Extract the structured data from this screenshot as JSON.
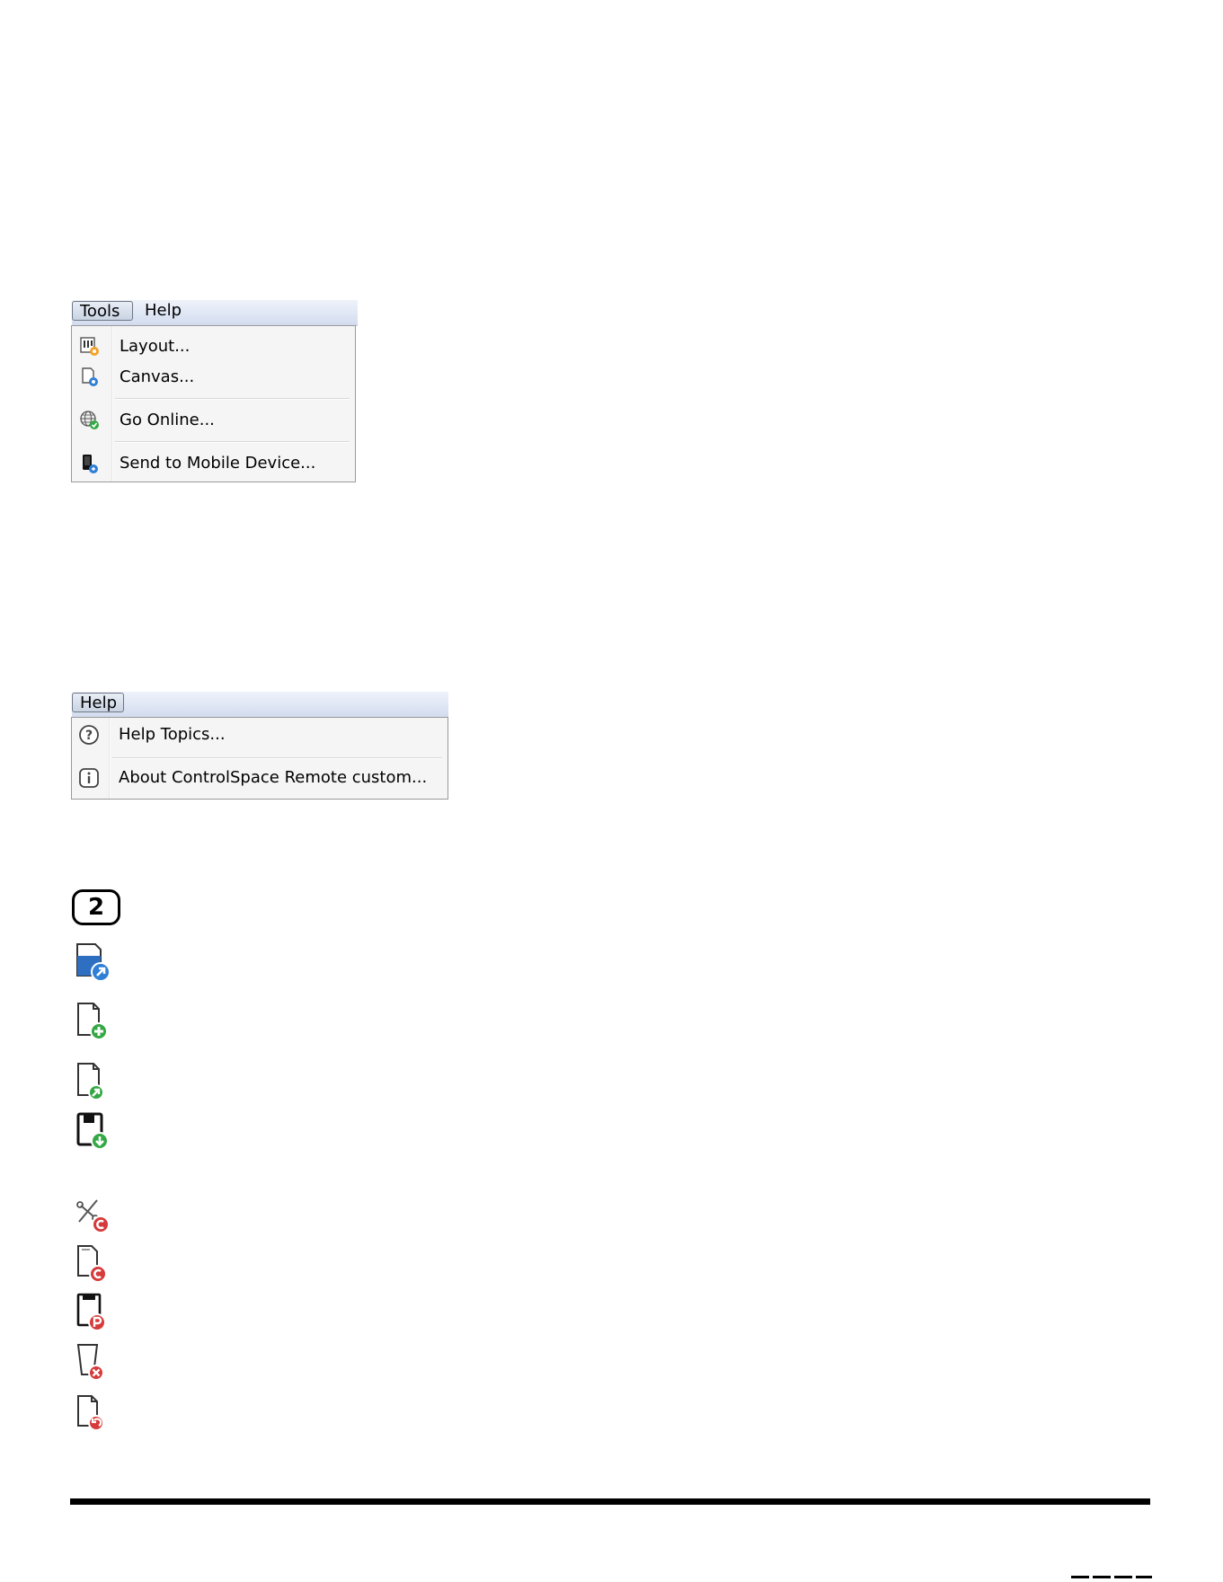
{
  "tools_menu": {
    "menubar": {
      "titles": [
        "Tools",
        "Help"
      ]
    },
    "items": [
      {
        "label": "Layout...",
        "icon": "layout-icon"
      },
      {
        "label": "Canvas...",
        "icon": "canvas-icon"
      },
      {
        "label": "Go Online...",
        "icon": "globe-online-icon"
      },
      {
        "label": "Send to Mobile Device...",
        "icon": "mobile-device-icon"
      }
    ]
  },
  "help_menu": {
    "menubar": {
      "titles": [
        "Help"
      ]
    },
    "items": [
      {
        "label": "Help Topics...",
        "icon": "question-mark-icon"
      },
      {
        "label": "About ControlSpace Remote custom...",
        "icon": "info-icon"
      }
    ]
  },
  "callout": {
    "number": "2"
  },
  "icons": [
    "open-file-icon",
    "new-file-icon",
    "open-recent-file-icon",
    "save-file-icon",
    "cut-icon",
    "copy-icon",
    "paste-icon",
    "delete-icon",
    "undo-icon"
  ],
  "colors": {
    "menubar_blue": "#dfe7f5",
    "icon_blue": "#2f7fd6",
    "icon_green": "#34a845",
    "icon_red": "#d63a3a"
  }
}
